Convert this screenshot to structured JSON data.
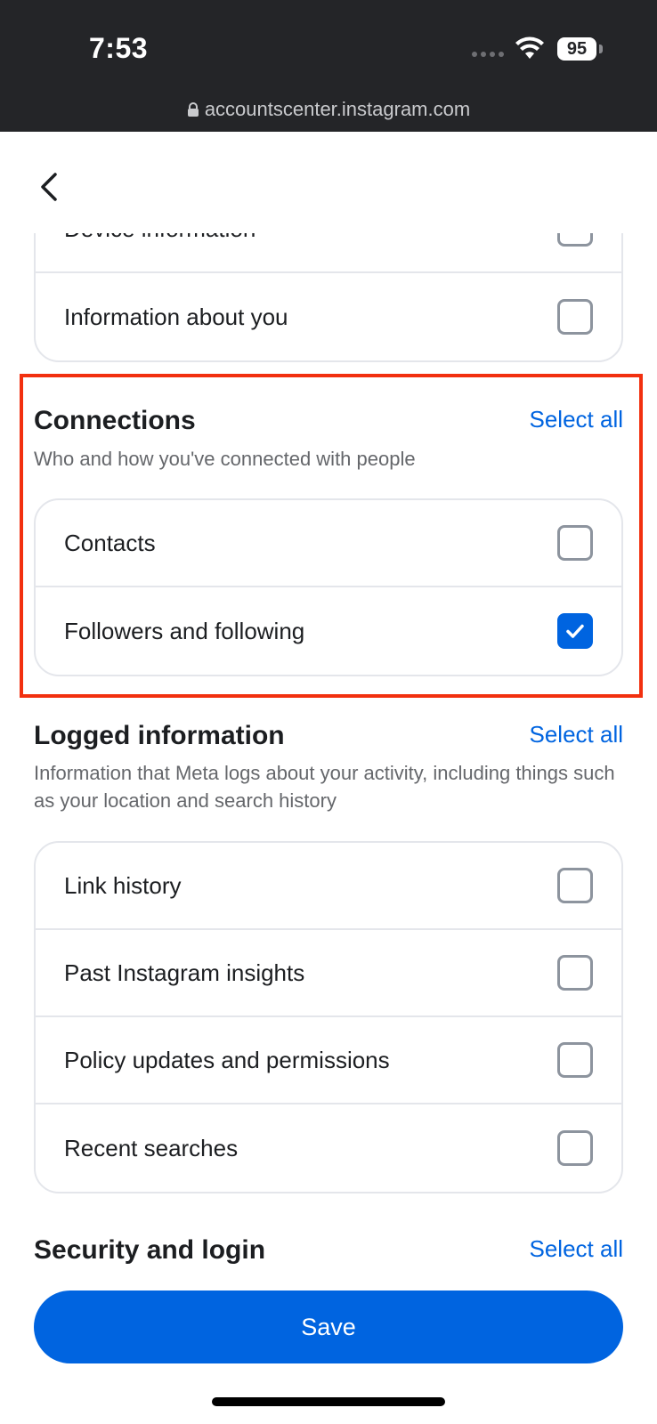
{
  "status_bar": {
    "time": "7:53",
    "battery": "95",
    "url": "accountscenter.instagram.com"
  },
  "header": {
    "back_icon": "chevron-left-icon"
  },
  "top_card": {
    "items": [
      {
        "label": "Device information",
        "checked": false
      },
      {
        "label": "Information about you",
        "checked": false
      }
    ]
  },
  "connections": {
    "title": "Connections",
    "select_all": "Select all",
    "description": "Who and how you've connected with people",
    "items": [
      {
        "label": "Contacts",
        "checked": false
      },
      {
        "label": "Followers and following",
        "checked": true
      }
    ]
  },
  "logged_information": {
    "title": "Logged information",
    "select_all": "Select all",
    "description": "Information that Meta logs about your activity, including things such as your location and search history",
    "items": [
      {
        "label": "Link history",
        "checked": false
      },
      {
        "label": "Past Instagram insights",
        "checked": false
      },
      {
        "label": "Policy updates and permissions",
        "checked": false
      },
      {
        "label": "Recent searches",
        "checked": false
      }
    ]
  },
  "security": {
    "title": "Security and login",
    "select_all": "Select all"
  },
  "footer": {
    "save_label": "Save"
  },
  "colors": {
    "accent": "#0064e0",
    "highlight_border": "#f2300f",
    "status_bar_bg": "#242528"
  }
}
